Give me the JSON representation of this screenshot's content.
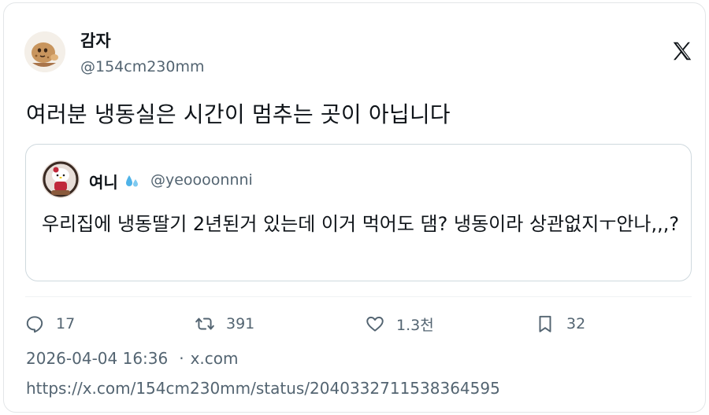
{
  "author": {
    "display_name": "감자",
    "handle": "@154cm230mm",
    "avatar_icon": "potato-emoji-avatar"
  },
  "platform_icon": "x-logo-icon",
  "tweet": {
    "text": "여러분 냉동실은 시간이 멈추는 곳이 아닙니다"
  },
  "quoted_tweet": {
    "display_name": "여니",
    "name_emoji": "sweat-droplets-icon",
    "handle": "@yeoooonnni",
    "text": "우리집에 냉동딸기 2년된거 있는데 이거 먹어도 댐? 냉동이라 상관없지ㅜ안나,,,?"
  },
  "actions": {
    "replies": "17",
    "reposts": "391",
    "likes": "1.3천",
    "bookmarks": "32"
  },
  "meta": {
    "timestamp": "2026-04-04 16:36",
    "separator": "·",
    "source": "x.com"
  },
  "status_url": "https://x.com/154cm230mm/status/2040332711538364595",
  "colors": {
    "text": "#0f1419",
    "secondary": "#536471",
    "border": "#cfd9de"
  }
}
